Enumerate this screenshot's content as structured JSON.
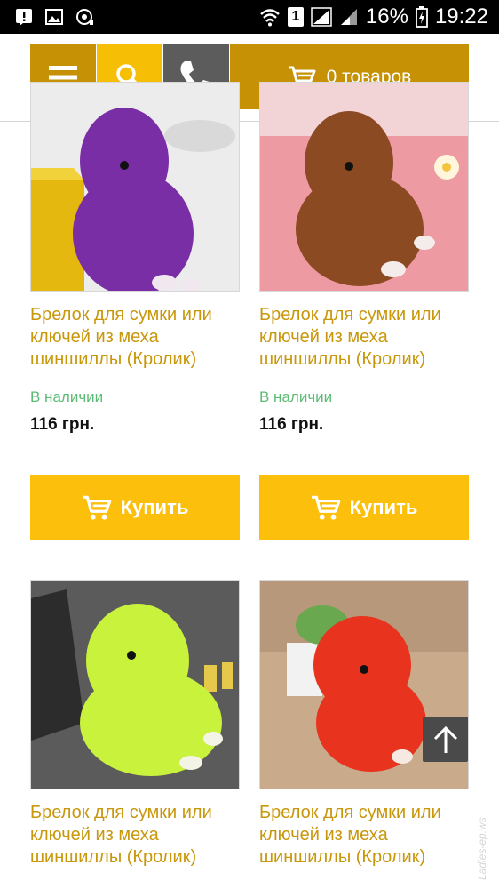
{
  "status_bar": {
    "battery": "16%",
    "time": "19:22",
    "sim": "1"
  },
  "header": {
    "cart_label": "0 товаров"
  },
  "products": [
    {
      "title": "Брелок для сумки или ключей из меха шиншиллы (Кролик)",
      "stock": "В наличии",
      "price": "116 грн.",
      "buy_label": "Купить",
      "fur_color": "#7a2ea6"
    },
    {
      "title": "Брелок для сумки или ключей из меха шиншиллы (Кролик)",
      "stock": "В наличии",
      "price": "116 грн.",
      "buy_label": "Купить",
      "fur_color": "#8b4a22"
    },
    {
      "title": "Брелок для сумки или ключей из меха шиншиллы (Кролик)",
      "fur_color": "#c9f23c"
    },
    {
      "title": "Брелок для сумки или ключей из меха шиншиллы (Кролик)",
      "fur_color": "#e8331e"
    }
  ],
  "watermark": "Ladies-ер.ws",
  "colors": {
    "accent_dark": "#c69105",
    "accent": "#f7be06",
    "buy_button": "#fcbf0c",
    "title_text": "#c8970b",
    "in_stock": "#5dbb76"
  },
  "icons": [
    "menu-icon",
    "search-icon",
    "phone-icon",
    "cart-icon",
    "arrow-up-icon"
  ]
}
